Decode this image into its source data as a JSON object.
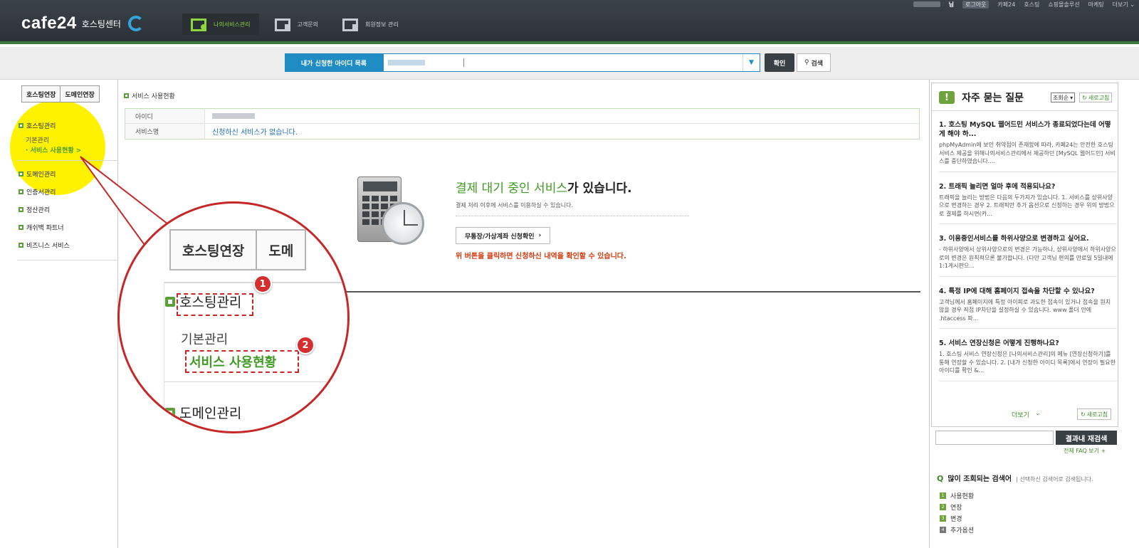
{
  "header": {
    "brand": "cafe24",
    "brand_sub": "호스팅센터",
    "util": {
      "user_suffix": "님",
      "logout": "로그아웃",
      "links": [
        "카페24",
        "호스팅",
        "쇼핑몰솔루션",
        "마케팅",
        "더보기 ⌄"
      ]
    },
    "gnb": [
      {
        "label": "나의서비스관리",
        "icon": "my-service-icon",
        "active": true
      },
      {
        "label": "고객문의",
        "icon": "support-icon",
        "active": false
      },
      {
        "label": "회원정보 관리",
        "icon": "member-icon",
        "active": false
      }
    ],
    "colors": {
      "accent": "#8dd63f",
      "header_bg": "#2f353a"
    }
  },
  "searchbar": {
    "label": "내가 신청한 아이디 목록",
    "confirm": "확인",
    "search": "검색",
    "colors": {
      "label_bg": "#1f8cc3"
    }
  },
  "sidebar": {
    "tabs": [
      "호스팅연장",
      "도메인연장"
    ],
    "groups": [
      {
        "label": "호스팅관리",
        "subs": [
          {
            "label": "기본관리",
            "active": false
          },
          {
            "label": "· 서비스 사용현황 >",
            "active": true
          }
        ]
      },
      {
        "label": "도메인관리"
      },
      {
        "label": "인증서관리"
      },
      {
        "label": "정산관리"
      },
      {
        "label": "캐쉬백 파트너"
      },
      {
        "label": "비즈니스 서비스"
      }
    ]
  },
  "main": {
    "breadcrumb": "서비스 사용현황",
    "table": {
      "rows": [
        {
          "th": "아이디",
          "td": ""
        },
        {
          "th": "서비스명",
          "td": "신청하신 서비스가 없습니다."
        }
      ]
    },
    "pending": {
      "title_green": "결제 대기 중인 서비스",
      "title_rest": "가 있습니다.",
      "desc": "결제 처리 이후에 서비스를 이용하실 수 있습니다.",
      "button": "무통장/가상계좌 신청확인",
      "note": "위 버튼을 클릭하면 신청하신 내역을 확인할 수 있습니다."
    }
  },
  "zoom": {
    "tabs": [
      "호스팅연장",
      "도메"
    ],
    "group1": "호스팅관리",
    "sub1": "기본관리",
    "sub2": "서비스 사용현황",
    "group2": "도메인관리",
    "badges": [
      "1",
      "2"
    ],
    "colors": {
      "highlight": "#fff200",
      "callout": "#c62828"
    }
  },
  "faq": {
    "title": "자주 묻는 질문",
    "sort": "조회순",
    "refresh": "새로고침",
    "items": [
      {
        "q": "1. 호스팅 MySQL 웹어드민 서비스가 종료되었다는데 어떻게 해야 하...",
        "a": "phpMyAdmin에 보안 취약점이 존재함에 따라, 카페24는 안전한 호스팅 서비스 제공을 위해나의서비스관리에서 제공하던 [MySQL 웹어드민] 서비스를 중단하였습니다...."
      },
      {
        "q": "2. 트래픽 늘리면 얼마 후에 적용되나요?",
        "a": "트래픽을 늘리는 방법은 다음의 두가지가 있습니다. 1. 서비스를 상위사양으로 변경하는 경우 2. 트래픽만 추가 옵션으로 신청하는 경우 위의 방법으로 결제를 하시면(카..."
      },
      {
        "q": "3. 이용중인서비스를 하위사양으로 변경하고 싶어요.",
        "a": "- 하위사양에서 상위사양으로의 변경은 가능하나, 상위사양에서 하위사양으로의 변경은 원칙적으론 불가합니다. (다만 고객님 편의를 만료일 5일내에 1:1게시판으..."
      },
      {
        "q": "4. 특정 IP에 대해 홈페이지 접속을 차단할 수 있나요?",
        "a": "고객님께서 홈페이지에 특정 아이피로 과도한 접속이 있거나 접속을 원치 않을 경우 직접 IP차단을 설정하실 수 있습니다. www 폴더 안에 .htaccess 파..."
      },
      {
        "q": "5. 서비스 연장신청은 어떻게 진행하나요?",
        "a": "1. 호스팅 서비스 연장신청은 [나의서비스관리]의 메뉴 [연장신청하기]를 통해 연장할 수 있습니다. 2. [내가 신청한 아이디 목록]에서 연장이 필요한 아이디를 확인 &..."
      }
    ],
    "more": "더보기",
    "search_button": "결과내 재검색",
    "all_faq": "전체 FAQ 보기 +",
    "popular_title": "많이 조회되는 검색어",
    "popular_desc": "| 선택하신 검색어로 검색됩니다.",
    "popular": [
      {
        "num": "1",
        "label": "사용현황"
      },
      {
        "num": "2",
        "label": "연장"
      },
      {
        "num": "3",
        "label": "변경"
      },
      {
        "num": "4",
        "label": "추가옵션"
      }
    ]
  }
}
